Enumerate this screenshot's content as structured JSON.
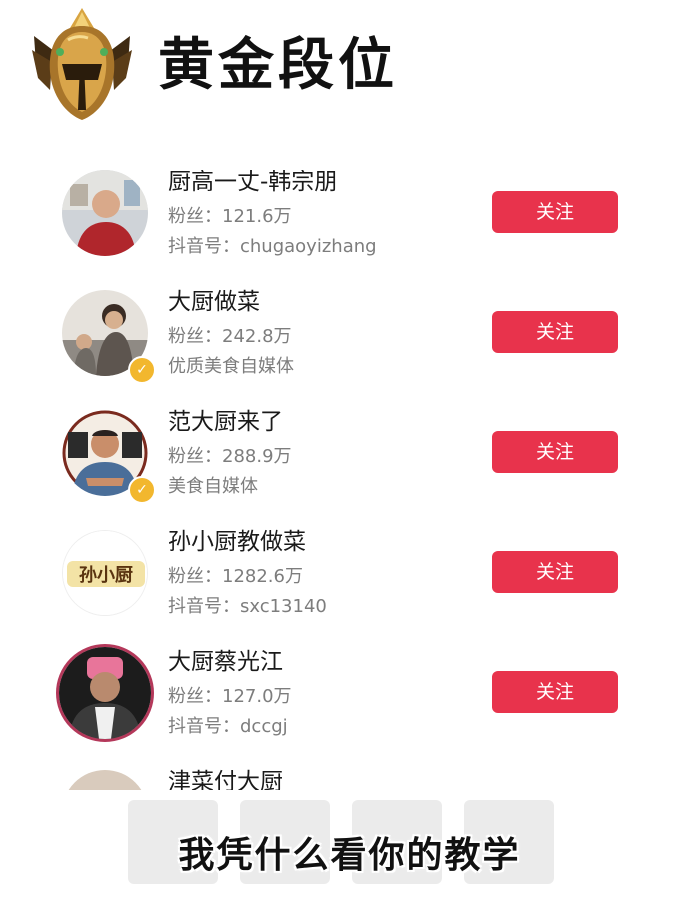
{
  "header": {
    "rank_icon": "gold-rank-helmet-icon",
    "title": "黄金段位"
  },
  "list": {
    "follow_label": "关注",
    "items": [
      {
        "name": "厨高一丈-韩宗朋",
        "fans": "粉丝：121.6万",
        "sub": "抖音号：chugaoyizhang",
        "verified": false
      },
      {
        "name": "大厨做菜",
        "fans": "粉丝：242.8万",
        "sub": "优质美食自媒体",
        "verified": true
      },
      {
        "name": "范大厨来了",
        "fans": "粉丝：288.9万",
        "sub": "美食自媒体",
        "verified": true
      },
      {
        "name": "孙小厨教做菜",
        "fans": "粉丝：1282.6万",
        "sub": "抖音号：sxc13140",
        "verified": false,
        "avatar_text": "孙小厨"
      },
      {
        "name": "大厨蔡光江",
        "fans": "粉丝：127.0万",
        "sub": "抖音号：dccgj",
        "verified": false
      },
      {
        "name": "津菜付大厨",
        "fans": "",
        "sub": "",
        "verified": false
      }
    ]
  },
  "caption": "我凭什么看你的教学",
  "colors": {
    "follow_button": "#e8334c",
    "verified_badge": "#f2b72e",
    "secondary_text": "#7d7d7d"
  }
}
